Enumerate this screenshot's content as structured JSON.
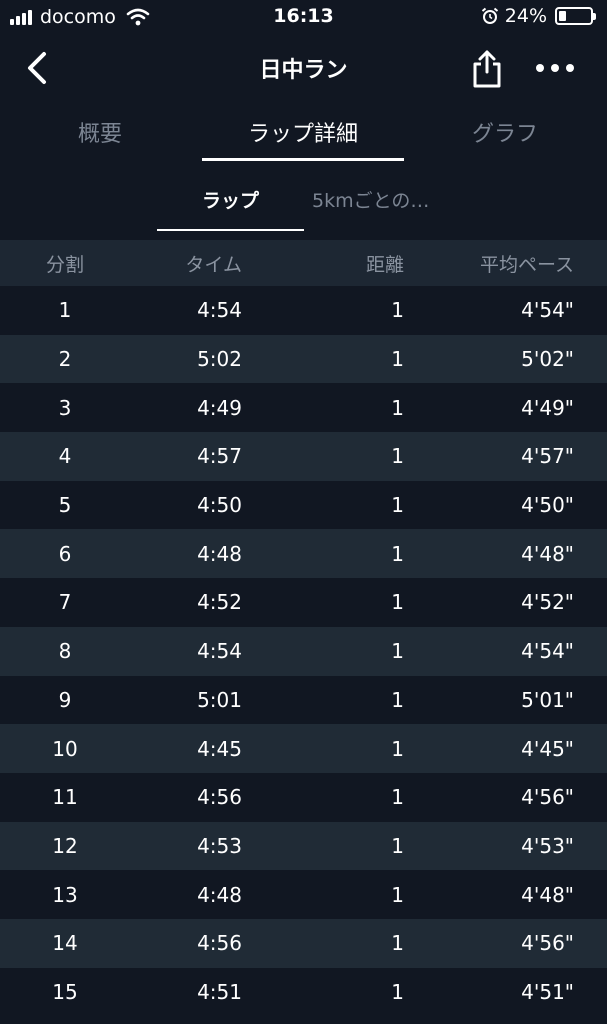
{
  "status": {
    "carrier": "docomo",
    "time": "16:13",
    "battery": "24%",
    "battery_level": 0.24
  },
  "nav": {
    "title": "日中ラン"
  },
  "tabs": [
    {
      "label": "概要"
    },
    {
      "label": "ラップ詳細"
    },
    {
      "label": "グラフ"
    }
  ],
  "subtabs": [
    {
      "label": "ラップ"
    },
    {
      "label": "5kmごとの…"
    }
  ],
  "table": {
    "headers": {
      "split": "分割",
      "time": "タイム",
      "distance": "距離",
      "pace": "平均ペース"
    },
    "rows": [
      {
        "split": "1",
        "time": "4:54",
        "distance": "1",
        "pace": "4'54\""
      },
      {
        "split": "2",
        "time": "5:02",
        "distance": "1",
        "pace": "5'02\""
      },
      {
        "split": "3",
        "time": "4:49",
        "distance": "1",
        "pace": "4'49\""
      },
      {
        "split": "4",
        "time": "4:57",
        "distance": "1",
        "pace": "4'57\""
      },
      {
        "split": "5",
        "time": "4:50",
        "distance": "1",
        "pace": "4'50\""
      },
      {
        "split": "6",
        "time": "4:48",
        "distance": "1",
        "pace": "4'48\""
      },
      {
        "split": "7",
        "time": "4:52",
        "distance": "1",
        "pace": "4'52\""
      },
      {
        "split": "8",
        "time": "4:54",
        "distance": "1",
        "pace": "4'54\""
      },
      {
        "split": "9",
        "time": "5:01",
        "distance": "1",
        "pace": "5'01\""
      },
      {
        "split": "10",
        "time": "4:45",
        "distance": "1",
        "pace": "4'45\""
      },
      {
        "split": "11",
        "time": "4:56",
        "distance": "1",
        "pace": "4'56\""
      },
      {
        "split": "12",
        "time": "4:53",
        "distance": "1",
        "pace": "4'53\""
      },
      {
        "split": "13",
        "time": "4:48",
        "distance": "1",
        "pace": "4'48\""
      },
      {
        "split": "14",
        "time": "4:56",
        "distance": "1",
        "pace": "4'56\""
      },
      {
        "split": "15",
        "time": "4:51",
        "distance": "1",
        "pace": "4'51\""
      }
    ]
  },
  "colors": {
    "background": "#111722",
    "row_alt": "#202b36",
    "header_bg": "#1d2733",
    "inactive_text": "#7c8593"
  },
  "icons": {
    "back": "chevron-left-icon",
    "share": "share-icon",
    "more": "more-dots-icon",
    "alarm": "alarm-clock-icon",
    "wifi": "wifi-icon",
    "signal": "signal-bars-icon",
    "battery": "battery-icon"
  }
}
